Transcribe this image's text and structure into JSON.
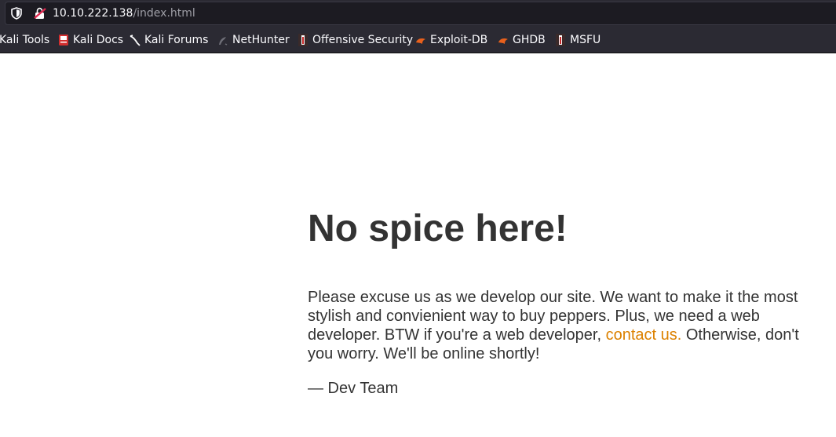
{
  "browser": {
    "url_host": "10.10.222.138",
    "url_path": "/index.html",
    "bookmarks": [
      {
        "label": "Kali Tools",
        "icon": "kali-tools-icon"
      },
      {
        "label": "Kali Docs",
        "icon": "kali-docs-icon"
      },
      {
        "label": "Kali Forums",
        "icon": "kali-forums-icon"
      },
      {
        "label": "NetHunter",
        "icon": "nethunter-icon"
      },
      {
        "label": "Offensive Security",
        "icon": "offsec-icon"
      },
      {
        "label": "Exploit-DB",
        "icon": "exploit-db-icon"
      },
      {
        "label": "GHDB",
        "icon": "ghdb-icon"
      },
      {
        "label": "MSFU",
        "icon": "msfu-icon"
      }
    ]
  },
  "page": {
    "title": "No spice here!",
    "body_before_link": "Please excuse us as we develop our site. We want to make it the most stylish and convienient way to buy peppers. Plus, we need a web developer. BTW if you're a web developer, ",
    "link_text": "contact us.",
    "body_after_link": " Otherwise, don't you worry. We'll be online shortly!",
    "signature": "— Dev Team",
    "link_color": "#dc8100",
    "text_color": "#333333"
  }
}
